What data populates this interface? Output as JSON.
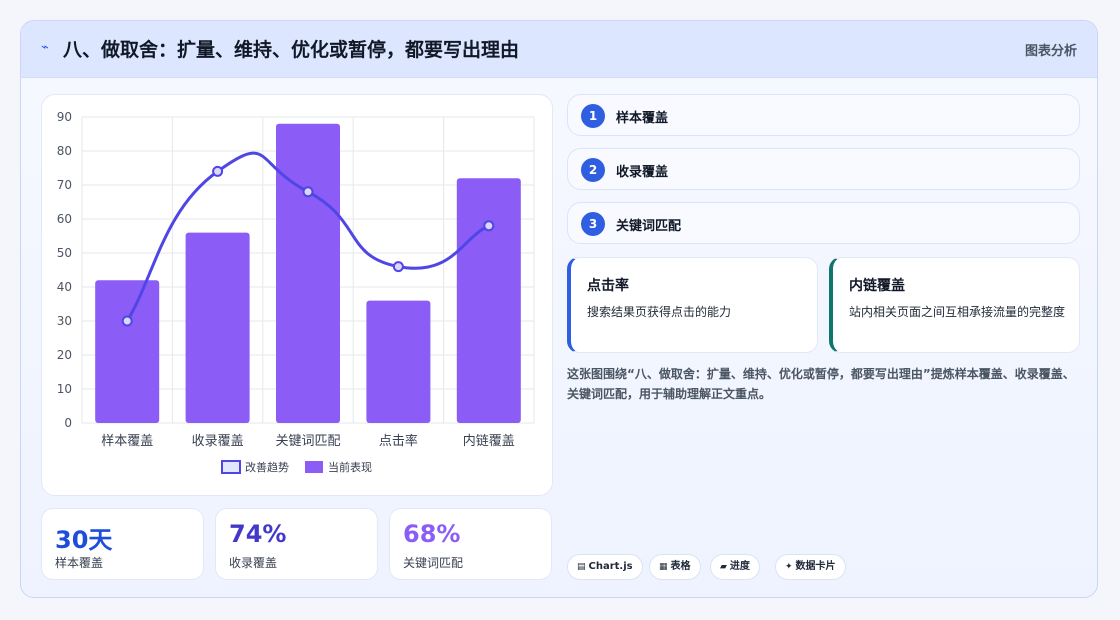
{
  "header": {
    "icon": "trend-icon",
    "title": "八、做取舍：扩量、维持、优化或暂停，都要写出理由",
    "tag": "图表分析"
  },
  "chart_data": {
    "type": "bar",
    "categories": [
      "样本覆盖",
      "收录覆盖",
      "关键词匹配",
      "点击率",
      "内链覆盖"
    ],
    "series": [
      {
        "name": "当前表现",
        "type": "bar",
        "color": "#8b5cf6",
        "values": [
          42,
          56,
          88,
          36,
          72
        ]
      },
      {
        "name": "改善趋势",
        "type": "line",
        "color": "#4f46e5",
        "values": [
          30,
          74,
          68,
          46,
          58
        ]
      }
    ],
    "ylim": [
      0,
      90
    ],
    "yticks": [
      0,
      10,
      20,
      30,
      40,
      50,
      60,
      70,
      80,
      90
    ],
    "legend_order": [
      "改善趋势",
      "当前表现"
    ],
    "legend": "bottom",
    "grid": true
  },
  "stats": [
    {
      "value": "30天",
      "label": "样本覆盖",
      "color": "#1d4ed8"
    },
    {
      "value": "74%",
      "label": "收录覆盖",
      "color": "#4338ca"
    },
    {
      "value": "68%",
      "label": "关键词匹配",
      "color": "#8b5cf6"
    }
  ],
  "steps": [
    {
      "num": "1",
      "label": "样本覆盖"
    },
    {
      "num": "2",
      "label": "收录覆盖"
    },
    {
      "num": "3",
      "label": "关键词匹配"
    }
  ],
  "cards": [
    {
      "title": "点击率",
      "desc": "搜索结果页获得点击的能力",
      "accent": "#2f5fe0"
    },
    {
      "title": "内链覆盖",
      "desc": "站内相关页面之间互相承接流量的完整度",
      "accent": "#0f766e"
    }
  ],
  "summary": "这张图围绕“八、做取舍：扩量、维持、优化或暂停，都要写出理由”提炼样本覆盖、收录覆盖、关键词匹配，用于辅助理解正文重点。",
  "chips": [
    {
      "icon": "▤",
      "label": "Chart.js"
    },
    {
      "icon": "▦",
      "label": "表格"
    },
    {
      "icon": "▰",
      "label": "进度"
    },
    {
      "icon": "✦",
      "label": "数据卡片"
    }
  ]
}
